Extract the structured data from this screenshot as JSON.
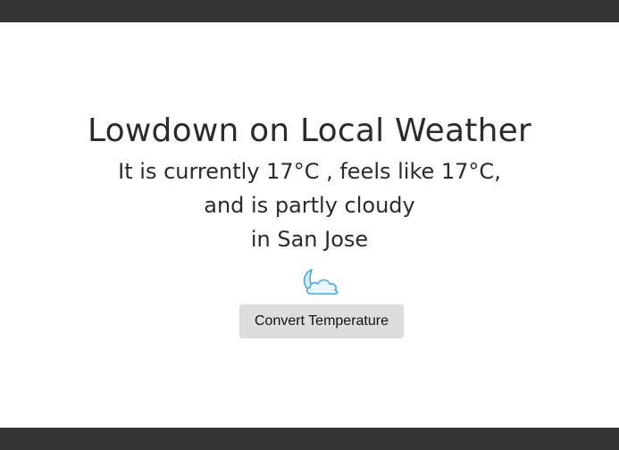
{
  "header": {
    "title": "Lowdown on Local Weather"
  },
  "weather": {
    "line1": "It is currently 17°C , feels like 17°C,",
    "line2": "and is partly cloudy",
    "line3": "in San Jose",
    "icon": "partly-cloudy-night-icon"
  },
  "actions": {
    "convert_label": "Convert Temperature"
  },
  "colors": {
    "bar": "#333333",
    "text": "#2b2b2b",
    "button_bg": "#dddddd",
    "icon_cloud": "#cfe6f5",
    "icon_outline": "#4aa8d8"
  }
}
